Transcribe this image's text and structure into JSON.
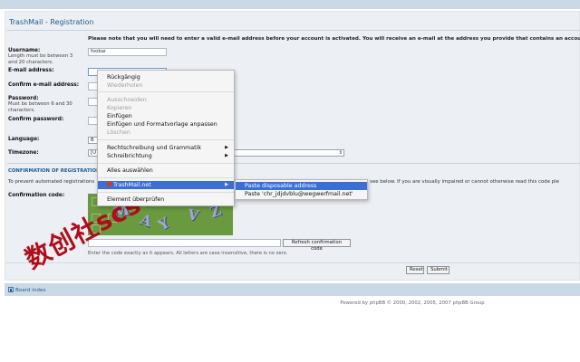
{
  "page": {
    "title": "TrashMail - Registration",
    "notice": "Please note that you will need to enter a valid e-mail address before your account is activated. You will receive an e-mail at the address you provide that contains an account"
  },
  "form": {
    "username_label": "Username:",
    "username_hint": "Length must be between 3 and 20 characters.",
    "username_value": "foobar",
    "email_label": "E-mail address:",
    "email_value": "",
    "confirm_email_label": "Confirm e-mail address:",
    "password_label": "Password:",
    "password_hint": "Must be between 6 and 30 characters.",
    "confirm_password_label": "Confirm password:",
    "language_label": "Language:",
    "language_value": "B",
    "timezone_label": "Timezone:",
    "timezone_value": "[U"
  },
  "confirmation": {
    "heading": "CONFIRMATION OF REGISTRATION",
    "intro_left": "To prevent automated registrations",
    "intro_right": "d see below. If you are visually impaired or cannot otherwise read this code ple",
    "code_label": "Confirmation code:",
    "captcha_glyphs": [
      "M",
      "A",
      "Y",
      "V",
      "Z"
    ],
    "refresh_button": "Refresh confirmation code",
    "hint": "Enter the code exactly as it appears. All letters are case insensitive, there is no zero."
  },
  "actions": {
    "reset": "Reset",
    "submit": "Submit"
  },
  "footer": {
    "board_index": "Board index",
    "powered_by": "Powered by phpBB © 2000, 2002, 2005, 2007 phpBB Group"
  },
  "context_menu": {
    "undo": "Rückgängig",
    "redo": "Wiederholen",
    "cut": "Ausschneiden",
    "copy": "Kopieren",
    "paste": "Einfügen",
    "paste_match": "Einfügen und Formatvorlage anpassen",
    "delete": "Löschen",
    "spelling": "Rechtschreibung und Grammatik",
    "writing_direction": "Schreibrichtung",
    "select_all": "Alles auswählen",
    "trashmail": "TrashMail.net",
    "inspect": "Element überprüfen"
  },
  "submenu": {
    "paste_disposable": "Paste disposable address",
    "paste_address": "Paste 'chr_jdjdvblu@wegwerfmail.net'"
  },
  "watermark": "数创社scs66",
  "colors": {
    "accent": "#1d5b8f",
    "menu_highlight": "#3b6fd6",
    "captcha_bg": "#6a9a3f",
    "watermark": "#b00d1a"
  }
}
